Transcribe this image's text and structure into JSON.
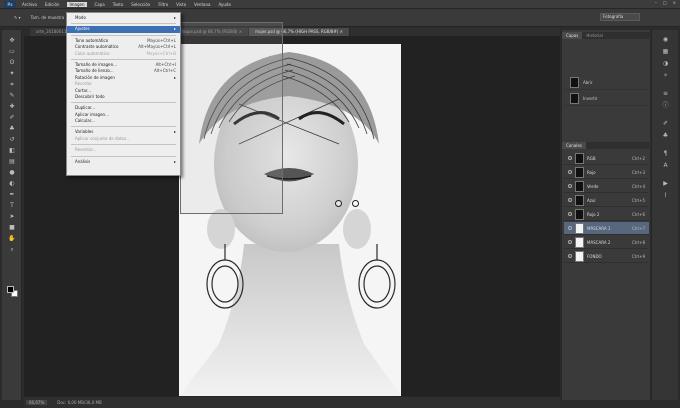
{
  "menubar": {
    "logo": "Ps",
    "items": [
      "Archivo",
      "Edición",
      "Imagen",
      "Capa",
      "Texto",
      "Selección",
      "Filtro",
      "Vista",
      "Ventana",
      "Ayuda"
    ],
    "active_index": 2
  },
  "options": {
    "items": [
      "Tam. de muestra",
      "Todas las capas",
      "Mostrar anillo de muestra"
    ],
    "workspace": "Fotografía"
  },
  "tabs": [
    "arte_20180611",
    "mujer-modelo.psd @ 66,7% (RGB/8) ×",
    "desenfoque.psd @ 66,7% (RGB/8) ×",
    "mujer.psd @ 66,7% (HIGH PASS, RGB/8#) ×"
  ],
  "active_tab": 3,
  "image_menu": {
    "items": [
      {
        "label": "Modo",
        "shortcut": "",
        "submenu": true
      },
      {
        "sep": true
      },
      {
        "label": "Ajustes",
        "shortcut": "",
        "submenu": true,
        "highlight": true
      },
      {
        "sep": true
      },
      {
        "label": "Tono automático",
        "shortcut": "Mayús+Ctrl+L"
      },
      {
        "label": "Contraste automático",
        "shortcut": "Alt+Mayús+Ctrl+L"
      },
      {
        "label": "Color automático",
        "shortcut": "Mayús+Ctrl+B",
        "disabled": true
      },
      {
        "sep": true
      },
      {
        "label": "Tamaño de imagen...",
        "shortcut": "Alt+Ctrl+I"
      },
      {
        "label": "Tamaño de lienzo...",
        "shortcut": "Alt+Ctrl+C"
      },
      {
        "label": "Rotación de imagen",
        "shortcut": "",
        "submenu": true
      },
      {
        "label": "Recortar",
        "shortcut": "",
        "disabled": true
      },
      {
        "label": "Cortar...",
        "shortcut": ""
      },
      {
        "label": "Descubrir todo",
        "shortcut": ""
      },
      {
        "sep": true
      },
      {
        "label": "Duplicar...",
        "shortcut": ""
      },
      {
        "label": "Aplicar imagen...",
        "shortcut": ""
      },
      {
        "label": "Calcular...",
        "shortcut": ""
      },
      {
        "sep": true
      },
      {
        "label": "Variables",
        "shortcut": "",
        "submenu": true
      },
      {
        "label": "Aplicar conjunto de datos...",
        "shortcut": "",
        "disabled": true
      },
      {
        "sep": true
      },
      {
        "label": "Reventar...",
        "shortcut": "",
        "disabled": true
      },
      {
        "sep": true
      },
      {
        "label": "Análisis",
        "shortcut": "",
        "submenu": true
      }
    ]
  },
  "history_panel": {
    "tabs": [
      "Capas",
      "Historial"
    ],
    "rows": [
      "Abrir",
      "Invertir"
    ]
  },
  "layers_panel": {
    "tab": "Canales",
    "rows": [
      {
        "name": "RGB",
        "shortcut": "Ctrl+2"
      },
      {
        "name": "Rojo",
        "shortcut": "Ctrl+3"
      },
      {
        "name": "Verde",
        "shortcut": "Ctrl+4"
      },
      {
        "name": "Azul",
        "shortcut": "Ctrl+5"
      },
      {
        "name": "Rojo 2",
        "shortcut": "Ctrl+6"
      },
      {
        "name": "MÁSCARA 1",
        "shortcut": "Ctrl+7",
        "selected": true
      },
      {
        "name": "MÁSCARA 2",
        "shortcut": "Ctrl+8"
      },
      {
        "name": "FONDO",
        "shortcut": "Ctrl+9"
      }
    ]
  },
  "status": {
    "zoom": "66,67%",
    "doc": "Doc: 6,00 MB/36,0 MB"
  }
}
